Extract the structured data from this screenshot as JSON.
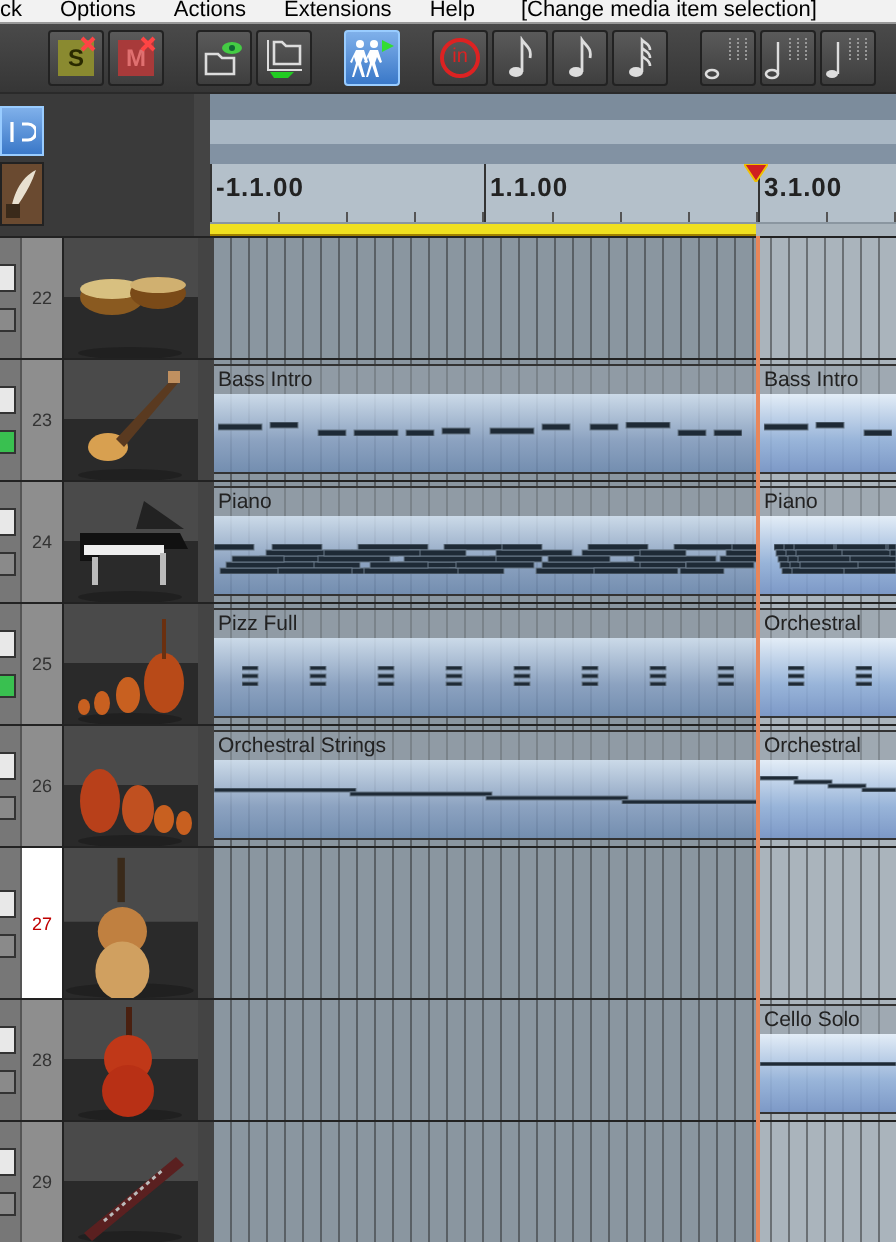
{
  "menu_bar": {
    "items": [
      "ck",
      "Options",
      "Actions",
      "Extensions",
      "Help"
    ],
    "status": "[Change media item selection]"
  },
  "toolbar": {
    "groups": [
      [
        {
          "kind": "solo-clear",
          "label": "S",
          "on": false
        },
        {
          "kind": "mute-clear",
          "label": "M",
          "on": false
        }
      ],
      [
        {
          "kind": "folder-eye",
          "on": false
        },
        {
          "kind": "folder",
          "on": false
        }
      ],
      [
        {
          "kind": "walkers",
          "on": true
        }
      ],
      [
        {
          "kind": "quantize",
          "label": "in",
          "on": false
        },
        {
          "kind": "eighth",
          "on": false
        },
        {
          "kind": "eighth",
          "on": false
        },
        {
          "kind": "thirtysecond",
          "on": false
        }
      ],
      [
        {
          "kind": "whole",
          "on": false
        },
        {
          "kind": "half",
          "on": false
        },
        {
          "kind": "quarter",
          "on": false
        }
      ]
    ]
  },
  "side_tools": [
    {
      "kind": "snap",
      "on": true
    },
    {
      "kind": "feather",
      "on": false
    }
  ],
  "ruler": {
    "marks": [
      "-1.1.00",
      "1.1.00",
      "3.1.00"
    ]
  },
  "tracks": [
    {
      "number": "22",
      "selected": false,
      "monitor": false
    },
    {
      "number": "23",
      "selected": false,
      "monitor": true,
      "clips": [
        {
          "title": "Bass Intro",
          "after_cursor": false,
          "kind": "bass"
        },
        {
          "title": "Bass Intro",
          "after_cursor": true,
          "kind": "bass"
        }
      ]
    },
    {
      "number": "24",
      "selected": false,
      "monitor": false,
      "clips": [
        {
          "title": "Piano",
          "after_cursor": false,
          "kind": "piano"
        },
        {
          "title": "Piano",
          "after_cursor": true,
          "kind": "piano"
        }
      ]
    },
    {
      "number": "25",
      "selected": false,
      "monitor": true,
      "clips": [
        {
          "title": "Pizz Full",
          "after_cursor": false,
          "kind": "pizz"
        },
        {
          "title": "Orchestral",
          "after_cursor": true,
          "kind": "pizz"
        }
      ]
    },
    {
      "number": "26",
      "selected": false,
      "monitor": false,
      "clips": [
        {
          "title": "Orchestral Strings",
          "after_cursor": false,
          "kind": "strings"
        },
        {
          "title": "Orchestral",
          "after_cursor": true,
          "kind": "strings"
        }
      ]
    },
    {
      "number": "27",
      "selected": true,
      "monitor": false
    },
    {
      "number": "28",
      "selected": false,
      "monitor": false,
      "clips": [
        {
          "title": "Cello Solo",
          "after_cursor": true,
          "kind": "solo"
        }
      ]
    },
    {
      "number": "29",
      "selected": false,
      "monitor": false
    }
  ]
}
